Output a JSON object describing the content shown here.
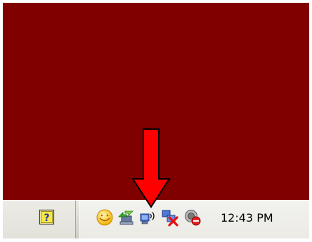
{
  "colors": {
    "desktop_background": "#800000",
    "taskbar_background": "#dcdcd3",
    "arrow_fill": "#ff0000",
    "arrow_outline": "#000000"
  },
  "quick_launch": {
    "icons": [
      "help-icon"
    ]
  },
  "system_tray": {
    "icons": [
      "smiley-messenger-icon",
      "network-green-arrows-icon",
      "wireless-network-icon",
      "network-disconnected-red-x-icon",
      "speaker-muted-icon"
    ],
    "clock": "12:43 PM"
  },
  "annotation": {
    "type": "red-down-arrow",
    "points_at": "wireless-network-icon"
  }
}
